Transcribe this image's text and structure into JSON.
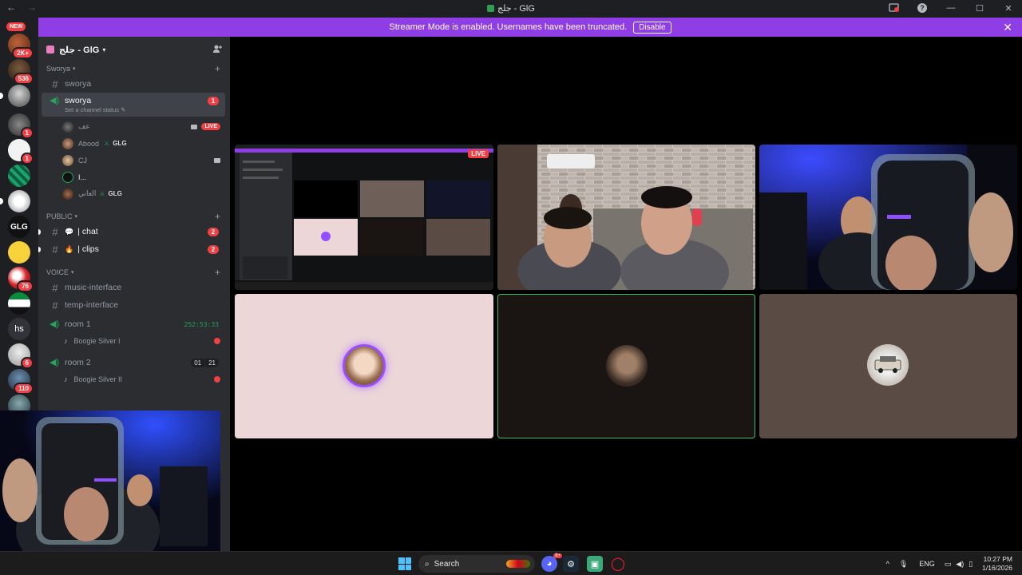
{
  "titlebar": {
    "back": "←",
    "forward": "→",
    "title": "جلج - GlG",
    "help": "?",
    "minimize": "—",
    "maximize": "☐",
    "close": "✕"
  },
  "rail": {
    "new_label": "NEW",
    "badges": [
      "2K+",
      "536",
      "1",
      "1",
      "76",
      "6",
      "110"
    ],
    "glg_label": "GLG",
    "hs_label": "hs"
  },
  "banner": {
    "text": "Streamer Mode is enabled. Usernames have been truncated.",
    "button": "Disable",
    "close": "✕"
  },
  "sidebar": {
    "server_name": "جلج - GlG",
    "categories": {
      "sworya": "Sworya",
      "public": "PUBLIC",
      "voice": "VOICE"
    },
    "channels": {
      "sworya_text": "sworya",
      "sworya_voice": "sworya",
      "sworya_status": "Set a channel status",
      "sworya_mentions": "1",
      "chat": "| chat",
      "chat_mentions": "2",
      "clips": "| clips",
      "clips_mentions": "2",
      "music": "music-interface",
      "temp": "temp-interface",
      "room1": "room 1",
      "room1_timer": "252:53:33",
      "room2": "room 2",
      "room2_count_a": "01",
      "room2_count_b": "21"
    },
    "voice_users": [
      {
        "name": "عف",
        "tag": "",
        "live": "LIVE"
      },
      {
        "name": "Abood",
        "tag": "GLG"
      },
      {
        "name": "CJ",
        "tag": ""
      },
      {
        "name": "I...",
        "tag": ""
      },
      {
        "name": "العاني",
        "tag": "GLG"
      }
    ],
    "room1_user": "Boogie Silver I",
    "room2_user": "Boogie Silver II"
  },
  "stage": {
    "live_label": "LIVE"
  },
  "taskbar": {
    "search": "Search",
    "discord_badge": "9+",
    "lang": "ENG",
    "time": "10:27 PM",
    "date": "1/16/2026"
  },
  "colors": {
    "banner": "#8f3ee6",
    "sidebar": "#2b2d31",
    "rail": "#1e1f22",
    "speaking": "#23a55a",
    "mention": "#f23f43"
  }
}
